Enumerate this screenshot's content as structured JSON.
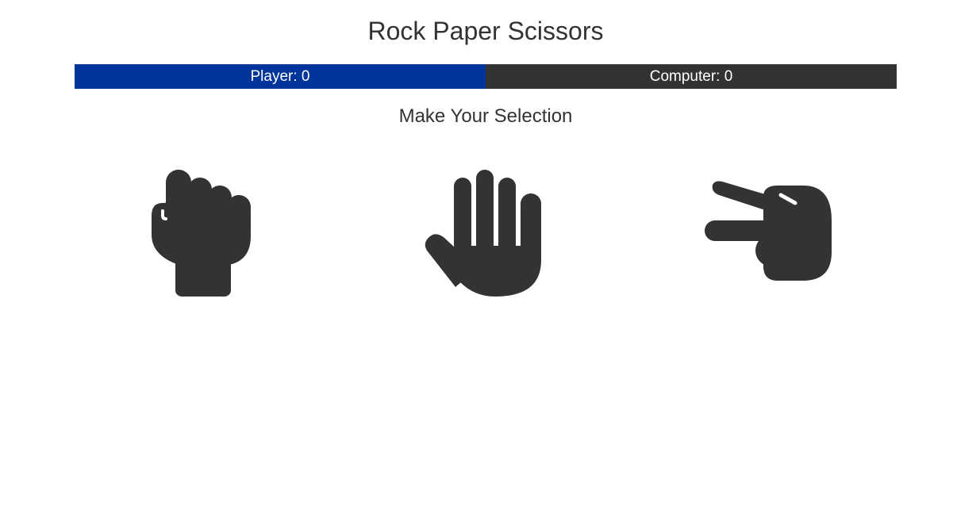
{
  "title": "Rock Paper Scissors",
  "scoreboard": {
    "player_label": "Player: 0",
    "computer_label": "Computer: 0"
  },
  "selection_prompt": "Make Your Selection",
  "choices": [
    {
      "name": "rock",
      "icon": "hand-fist-icon"
    },
    {
      "name": "paper",
      "icon": "hand-paper-icon"
    },
    {
      "name": "scissors",
      "icon": "hand-scissors-icon"
    }
  ],
  "colors": {
    "player": "#00359c",
    "computer": "#333333",
    "icon": "#333333",
    "text": "#333333"
  }
}
